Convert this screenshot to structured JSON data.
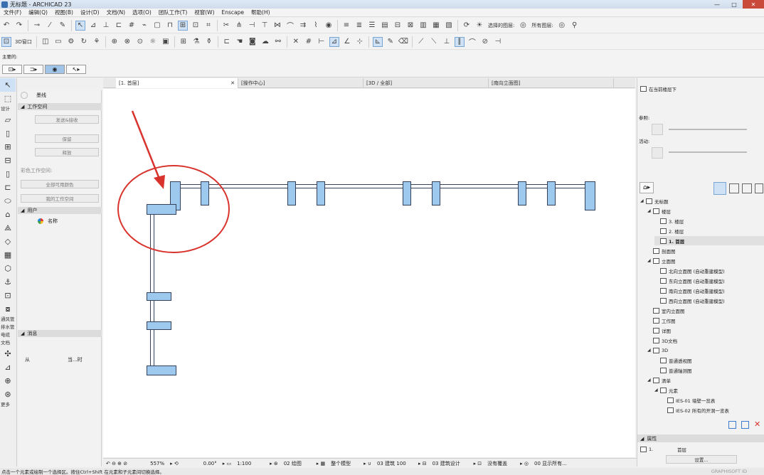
{
  "window": {
    "title": "无标题 - ARCHICAD 23",
    "controls": [
      "—",
      "□",
      "✕"
    ]
  },
  "menu": [
    "文件(F)",
    "编辑(Q)",
    "视图(B)",
    "设计(D)",
    "文档(N)",
    "选项(O)",
    "团队工作(T)",
    "视窗(W)",
    "Enscape",
    "帮助(H)"
  ],
  "toolbar1": {
    "layer_label": "选择的图层:",
    "all_layers_label": "所有图层:"
  },
  "toolbar2": {
    "window_3d": "3D窗口"
  },
  "infobox": {
    "label": "主要的:"
  },
  "toolbox": {
    "section_design": "设计",
    "section_doc": "文档",
    "labels_bottom": [
      "通风管",
      "排水管",
      "电缆",
      "文档"
    ],
    "more_label": "更多"
  },
  "left_panel": {
    "breadcrumb": "墨线",
    "workspace_header": "工作空间",
    "send_receive": "发送&接收",
    "reserve": "保留",
    "release": "释放",
    "color_label": "彩色工作空间:",
    "color_select": "全部可用颜色",
    "my_workspace": "我的工作空间",
    "users_header": "用户",
    "name_label": "名称",
    "messages_header": "消息",
    "from_label": "从",
    "time_label": "当...时"
  },
  "tabs": [
    {
      "label": "[1. 首层]",
      "active": true
    },
    {
      "label": "[操作中心]",
      "active": false
    },
    {
      "label": "[3D / 全部]",
      "active": false
    },
    {
      "label": "[南向立面图]",
      "active": false
    }
  ],
  "right_panel": {
    "current_floor": "在当前楼层下",
    "reference_label": "参照:",
    "active_label": "活动:",
    "tree": [
      {
        "label": "无标题",
        "level": 0,
        "arrow": "◢"
      },
      {
        "label": "楼层",
        "level": 1,
        "arrow": "◢"
      },
      {
        "label": "3. 楼层",
        "level": 2,
        "arrow": ""
      },
      {
        "label": "2. 楼层",
        "level": 2,
        "arrow": ""
      },
      {
        "label": "1. 首层",
        "level": 2,
        "arrow": "",
        "selected": true
      },
      {
        "label": "剖面图",
        "level": 1,
        "arrow": ""
      },
      {
        "label": "立面图",
        "level": 1,
        "arrow": "◢"
      },
      {
        "label": "北向立面图 (自动重建模型)",
        "level": 2,
        "arrow": ""
      },
      {
        "label": "东向立面图 (自动重建模型)",
        "level": 2,
        "arrow": ""
      },
      {
        "label": "南向立面图 (自动重建模型)",
        "level": 2,
        "arrow": ""
      },
      {
        "label": "西向立面图 (自动重建模型)",
        "level": 2,
        "arrow": ""
      },
      {
        "label": "室内立面图",
        "level": 1,
        "arrow": ""
      },
      {
        "label": "工作图",
        "level": 1,
        "arrow": ""
      },
      {
        "label": "详图",
        "level": 1,
        "arrow": ""
      },
      {
        "label": "3D文档",
        "level": 1,
        "arrow": ""
      },
      {
        "label": "3D",
        "level": 1,
        "arrow": "◢"
      },
      {
        "label": "普通透视图",
        "level": 2,
        "arrow": ""
      },
      {
        "label": "普通轴测图",
        "level": 2,
        "arrow": ""
      },
      {
        "label": "清单",
        "level": 1,
        "arrow": "◢"
      },
      {
        "label": "元素",
        "level": 2,
        "arrow": "◢"
      },
      {
        "label": "IES-01 墙壁一览表",
        "level": 3,
        "arrow": ""
      },
      {
        "label": "IES-02 所有的开洞一览表",
        "level": 3,
        "arrow": ""
      }
    ],
    "properties_header": "属性",
    "prop_number": "1.",
    "prop_name": "首层",
    "settings_button": "设置..."
  },
  "statusbar": {
    "zoom": "557%",
    "angle": "0.00°",
    "scale": "1:100",
    "layer_combo": "02 绘图",
    "model": "整个模型",
    "pen": "03 建筑 100",
    "mvo": "03 建筑设计",
    "override": "没有覆盖",
    "display": "00 显示所有..."
  },
  "hint": "点击一个元素或绘制一个选择区。按住Ctrl+Shift 在元素和子元素间切换选择。",
  "brand": "GRAPHISOFT ID"
}
